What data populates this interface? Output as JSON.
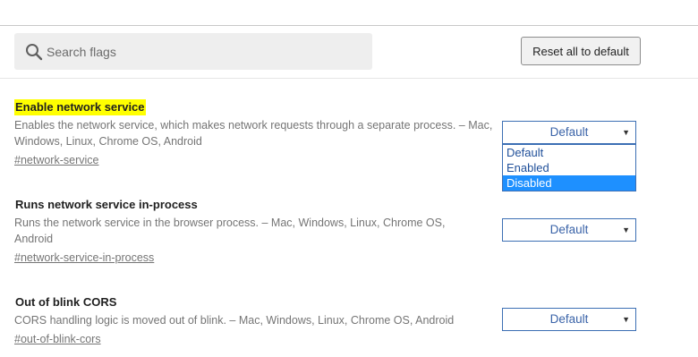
{
  "search": {
    "placeholder": "Search flags",
    "value": ""
  },
  "toolbar": {
    "reset_label": "Reset all to default"
  },
  "flags": [
    {
      "title": "Enable network service",
      "description": "Enables the network service, which makes network requests through a separate process. – Mac, Windows, Linux, Chrome OS, Android",
      "link": "#network-service",
      "selected": "Default",
      "highlighted": true
    },
    {
      "title": "Runs network service in-process",
      "description": "Runs the network service in the browser process. – Mac, Windows, Linux, Chrome OS, Android",
      "link": "#network-service-in-process",
      "selected": "Default"
    },
    {
      "title": "Out of blink CORS",
      "description": "CORS handling logic is moved out of blink. – Mac, Windows, Linux, Chrome OS, Android",
      "link": "#out-of-blink-cors",
      "selected": "Default"
    }
  ],
  "dropdown": {
    "options": [
      "Default",
      "Enabled",
      "Disabled"
    ],
    "highlighted": "Disabled"
  },
  "icons": {
    "search": "search-icon",
    "caret": "chevron-down-icon"
  },
  "colors": {
    "highlight": "#ffff00",
    "select_border": "#3c6fb4",
    "option_selected": "#1e90ff"
  }
}
